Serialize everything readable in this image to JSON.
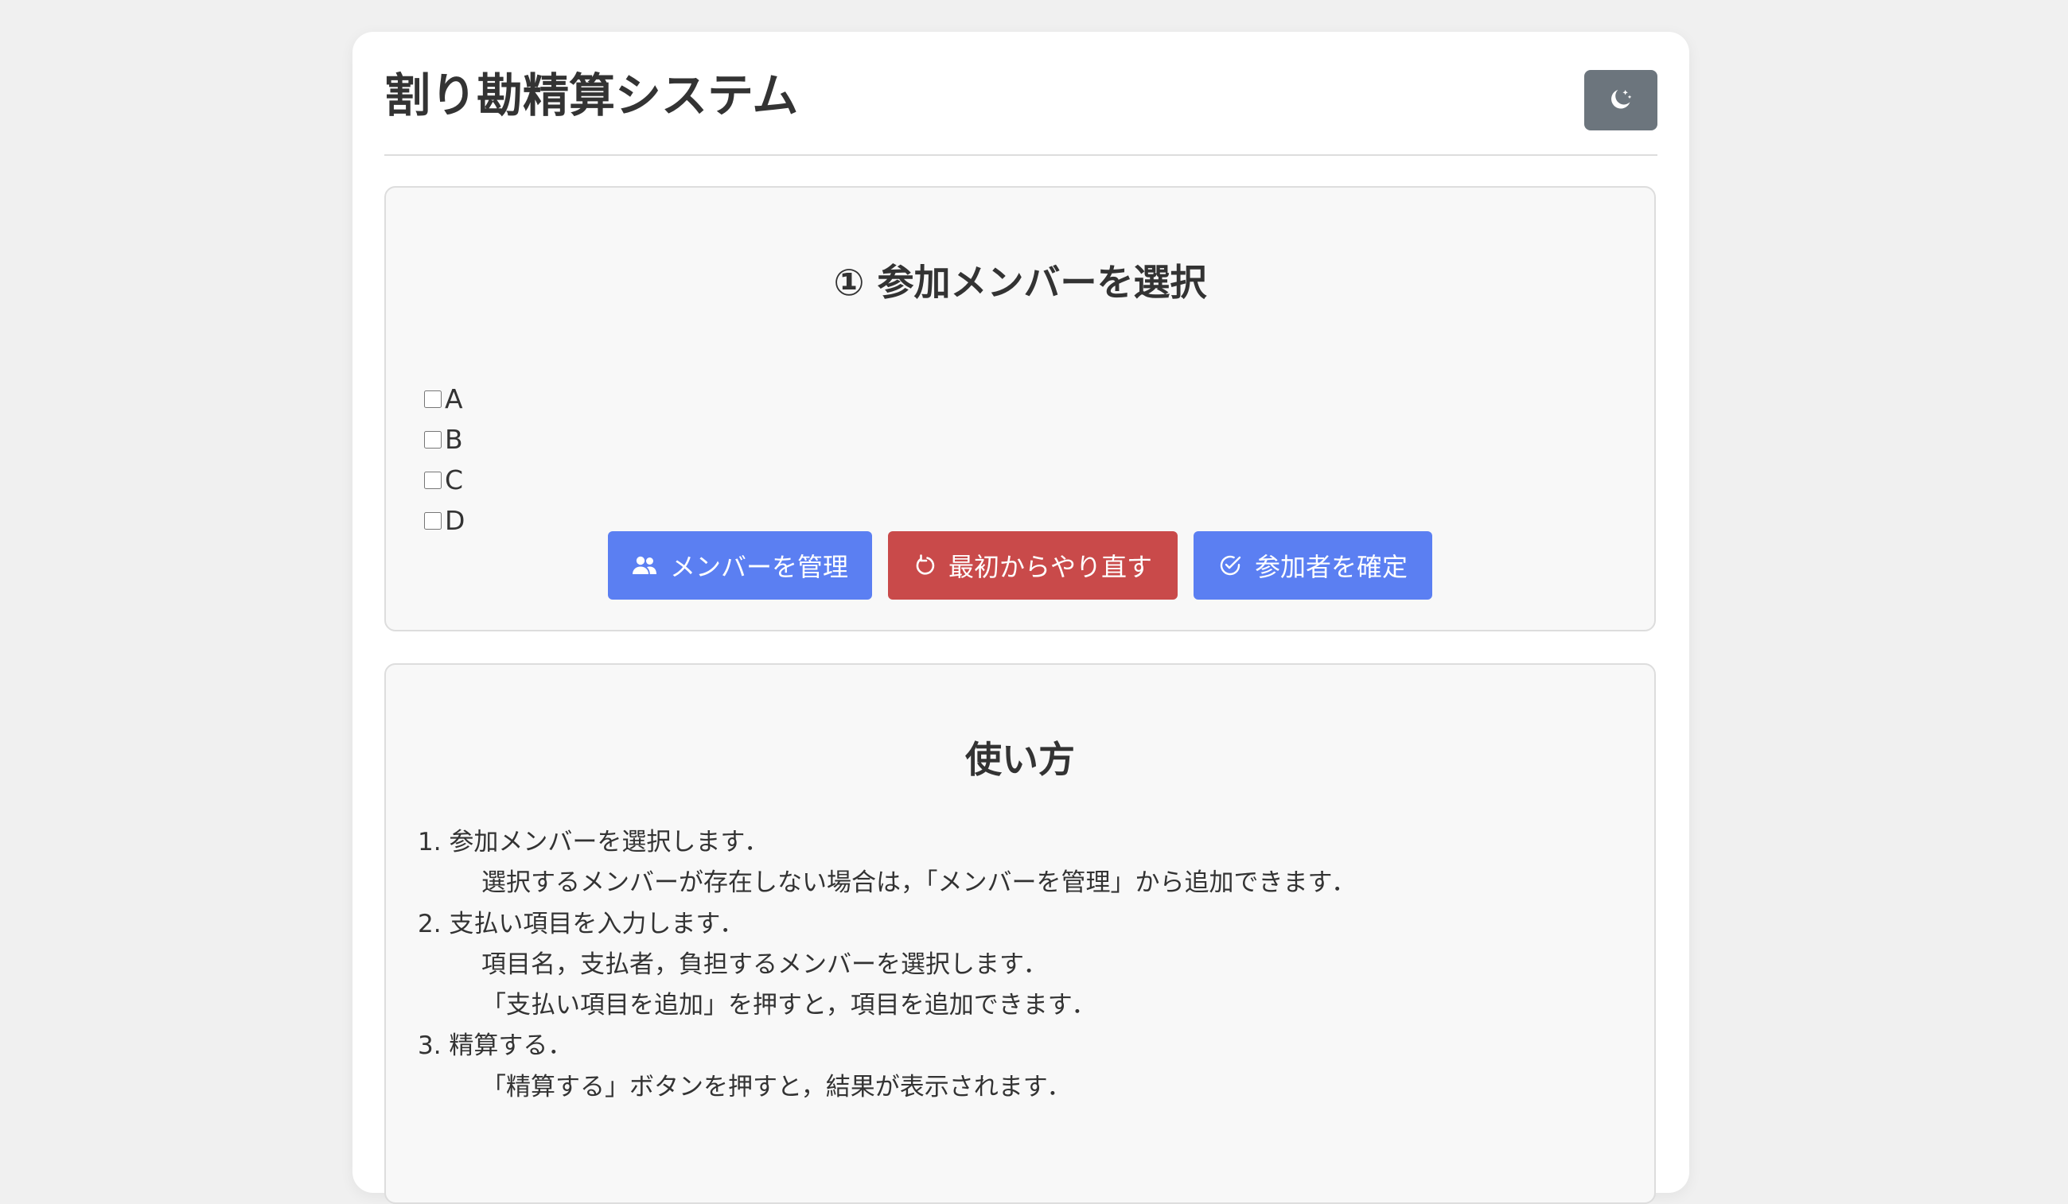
{
  "app": {
    "title": "割り勘精算システム",
    "theme_toggle_icon": "moon-stars-icon"
  },
  "colors": {
    "primary": "#5b7ff2",
    "danger": "#c94a4a",
    "secondary": "#6c757d",
    "background": "#f0f0f0",
    "card": "#f8f8f8"
  },
  "member_section": {
    "title": "① 参加メンバーを選択",
    "members": [
      {
        "label": "A",
        "checked": false
      },
      {
        "label": "B",
        "checked": false
      },
      {
        "label": "C",
        "checked": false
      },
      {
        "label": "D",
        "checked": false
      }
    ],
    "buttons": {
      "manage": {
        "label": "メンバーを管理",
        "icon": "people-icon"
      },
      "reset": {
        "label": "最初からやり直す",
        "icon": "restart-icon"
      },
      "confirm": {
        "label": "参加者を確定",
        "icon": "check-circle-icon"
      }
    }
  },
  "howto": {
    "title": "使い方",
    "steps": [
      {
        "text": "1. 参加メンバーを選択します．",
        "details": [
          "選択するメンバーが存在しない場合は，「メンバーを管理」から追加できます．"
        ]
      },
      {
        "text": "2. 支払い項目を入力します．",
        "details": [
          "項目名，支払者，負担するメンバーを選択します．",
          "「支払い項目を追加」を押すと，項目を追加できます．"
        ]
      },
      {
        "text": "3. 精算する．",
        "details": [
          "「精算する」ボタンを押すと，結果が表示されます．"
        ]
      }
    ]
  }
}
